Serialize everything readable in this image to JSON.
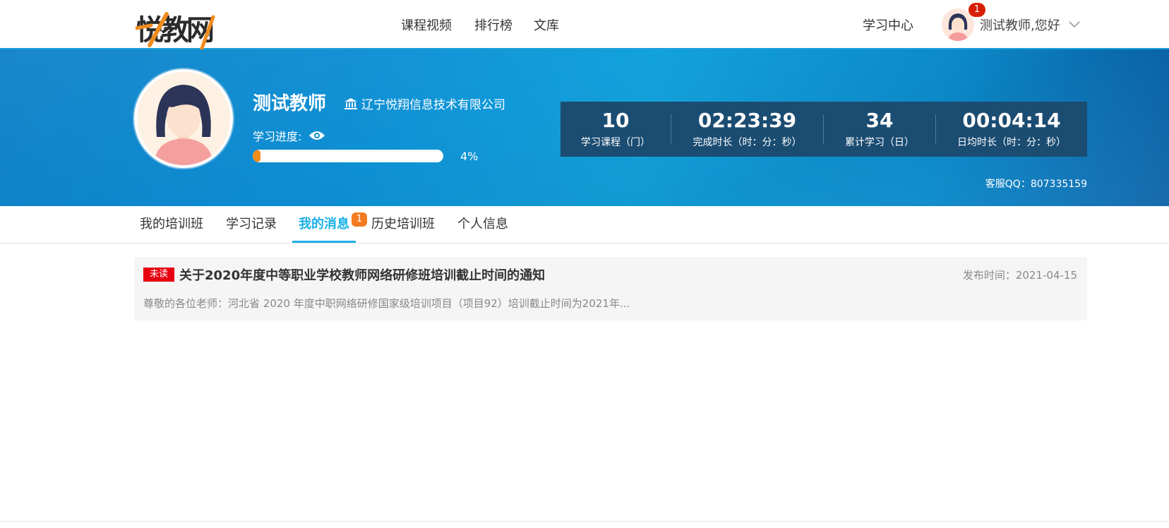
{
  "header": {
    "logo_text": "悦教网",
    "nav": [
      "课程视频",
      "排行榜",
      "文库"
    ],
    "study_center": "学习中心",
    "notification_count": "1",
    "greeting": "测试教师,您好"
  },
  "profile": {
    "name": "测试教师",
    "organization": "辽宁悦翔信息技术有限公司",
    "progress_label": "学习进度:",
    "progress_percent": "4%",
    "progress_value": 0.04
  },
  "stats": [
    {
      "value": "10",
      "label": "学习课程（门）"
    },
    {
      "value": "02:23:39",
      "label": "完成时长（时：分：秒）"
    },
    {
      "value": "34",
      "label": "累计学习（日）"
    },
    {
      "value": "00:04:14",
      "label": "日均时长（时：分：秒）"
    }
  ],
  "service_qq": "客服QQ：807335159",
  "tabs": {
    "items": [
      "我的培训班",
      "学习记录",
      "我的消息",
      "历史培训班",
      "个人信息"
    ],
    "active": "我的消息",
    "message_badge": "1"
  },
  "messages": [
    {
      "tag": "未读",
      "title": "关于2020年度中等职业学校教师网络研修班培训截止时间的通知",
      "date": "发布时间：2021-04-15",
      "summary": "尊敬的各位老师：河北省 2020 年度中职网络研修国家级培训项目（项目92）培训截止时间为2021年..."
    }
  ],
  "colors": {
    "accent": "#1ab0e8",
    "banner": "#0e8fd4",
    "stats_panel": "#1b4c72",
    "progress": "#f08c1e",
    "unread": "#e60012",
    "badge": "#f47b20"
  }
}
